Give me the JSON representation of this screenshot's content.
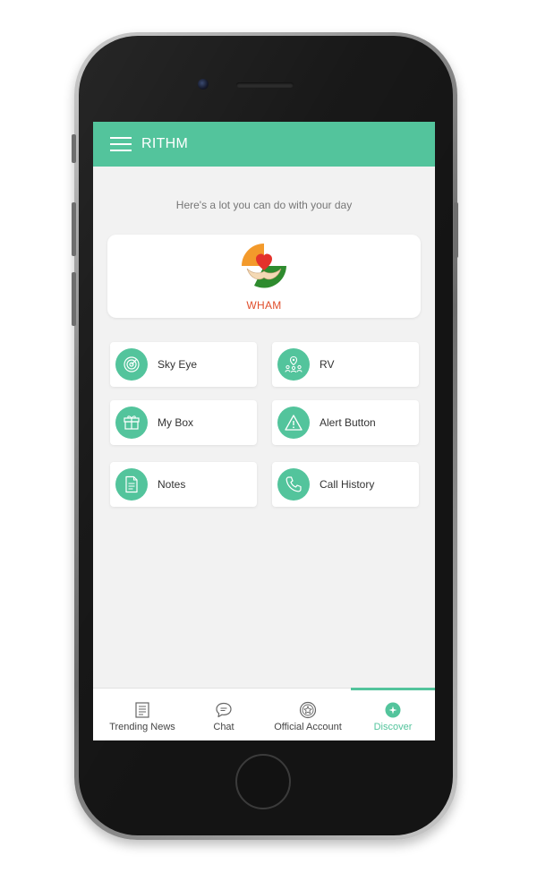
{
  "app": {
    "title": "RITHM",
    "accent_color": "#53c49c"
  },
  "main": {
    "tagline": "Here's a lot you can do with your day",
    "featured": {
      "label": "WHAM",
      "icon": "heart-hands-logo"
    },
    "tiles": [
      {
        "label": "Sky Eye",
        "icon": "radar-icon"
      },
      {
        "label": "RV",
        "icon": "location-people-icon"
      },
      {
        "label": "My Box",
        "icon": "gift-box-icon"
      },
      {
        "label": "Alert Button",
        "icon": "warning-icon"
      },
      {
        "label": "Notes",
        "icon": "document-icon"
      },
      {
        "label": "Call History",
        "icon": "phone-icon"
      }
    ]
  },
  "bottom_nav": {
    "items": [
      {
        "label": "Trending News",
        "icon": "newspaper-icon",
        "active": false
      },
      {
        "label": "Chat",
        "icon": "chat-bubble-icon",
        "active": false
      },
      {
        "label": "Official Account",
        "icon": "star-badge-icon",
        "active": false
      },
      {
        "label": "Discover",
        "icon": "compass-icon",
        "active": true
      }
    ]
  }
}
